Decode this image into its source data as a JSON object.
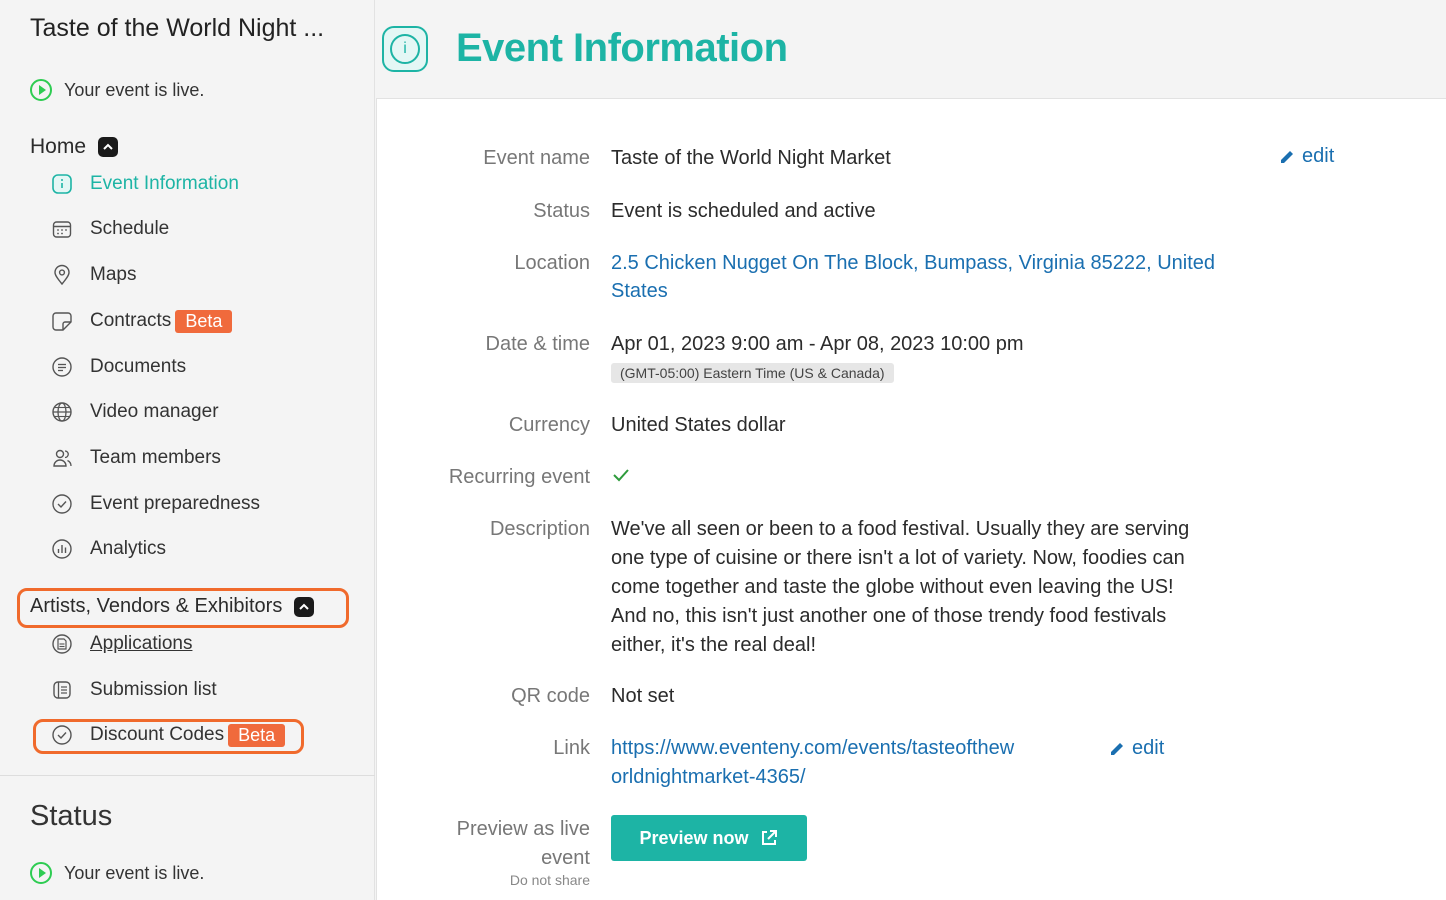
{
  "sidebar": {
    "event_title": "Taste of the World Night ...",
    "live_status": "Your event is live.",
    "home_section": "Home",
    "home_items": [
      {
        "label": "Event Information",
        "icon": "info-icon"
      },
      {
        "label": "Schedule",
        "icon": "calendar-icon"
      },
      {
        "label": "Maps",
        "icon": "map-pin-icon"
      },
      {
        "label": "Contracts",
        "icon": "contract-icon",
        "badge": "Beta"
      },
      {
        "label": "Documents",
        "icon": "document-icon"
      },
      {
        "label": "Video manager",
        "icon": "globe-icon"
      },
      {
        "label": "Team members",
        "icon": "team-icon"
      },
      {
        "label": "Event preparedness",
        "icon": "check-circle-icon"
      },
      {
        "label": "Analytics",
        "icon": "analytics-icon"
      }
    ],
    "vendors_section": "Artists, Vendors & Exhibitors",
    "vendor_items": [
      {
        "label": "Applications",
        "icon": "application-icon"
      },
      {
        "label": "Submission list",
        "icon": "list-icon"
      },
      {
        "label": "Discount Codes",
        "icon": "discount-icon",
        "badge": "Beta"
      }
    ],
    "status_title": "Status",
    "status_live": "Your event is live."
  },
  "header": {
    "title": "Event Information"
  },
  "details": {
    "event_name_label": "Event name",
    "event_name": "Taste of the World Night Market",
    "edit_label": "edit",
    "status_label": "Status",
    "status": "Event is scheduled and active",
    "location_label": "Location",
    "location_line1": "2.5 Chicken Nugget On The Block, Bumpass, Virginia 85222, United",
    "location_line2": "States",
    "datetime_label": "Date & time",
    "datetime": "Apr 01, 2023 9:00 am - Apr 08, 2023 10:00 pm",
    "timezone": "(GMT-05:00) Eastern Time (US & Canada)",
    "currency_label": "Currency",
    "currency": "United States dollar",
    "recurring_label": "Recurring event",
    "recurring": true,
    "description_label": "Description",
    "description_lines": [
      "We've all seen or been to a food festival. Usually they are serving",
      "one type of cuisine or there isn't a lot of variety. Now, foodies can",
      "come together and taste the globe without even leaving the US!",
      "And no, this isn't just another one of those trendy food festivals",
      "either, it's the real deal!"
    ],
    "qr_label": "QR code",
    "qr_value": "Not set",
    "link_label": "Link",
    "link_line1": "https://www.eventeny.com/events/tasteofthew",
    "link_line2": "orldnightmarket-4365/",
    "preview_label_line1": "Preview as live",
    "preview_label_line2": "event",
    "preview_note": "Do not share",
    "preview_button": "Preview now"
  },
  "colors": {
    "accent": "#1db4a5",
    "link": "#1a6fb0",
    "beta": "#f06a3c",
    "highlight": "#f06a2c",
    "live": "#2ecc52"
  }
}
